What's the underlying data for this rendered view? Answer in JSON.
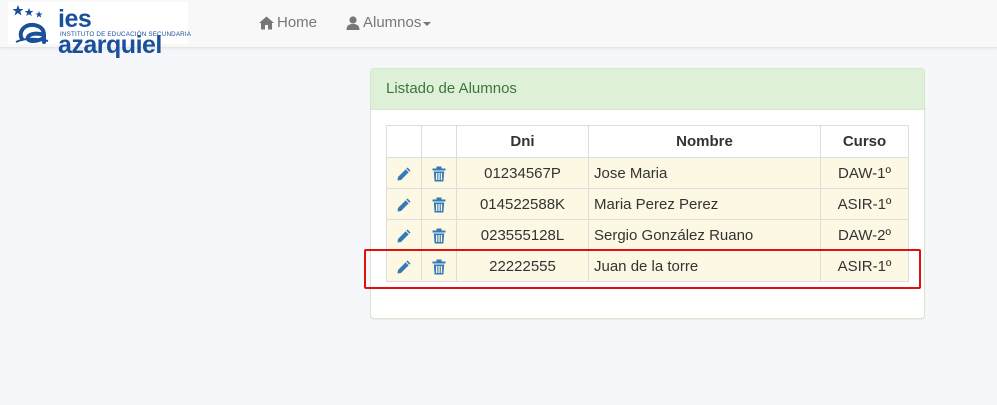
{
  "navbar": {
    "brand": {
      "name": "ies azarquiel",
      "subtitle": "INSTITUTO DE EDUCACIÓN SECUNDARIA"
    },
    "home_label": "Home",
    "alumnos_label": "Alumnos"
  },
  "panel": {
    "title": "Listado de Alumnos",
    "columns": [
      "",
      "",
      "Dni",
      "Nombre",
      "Curso"
    ],
    "rows": [
      {
        "dni": "01234567P",
        "nombre": "Jose Maria",
        "curso": "DAW-1º"
      },
      {
        "dni": "014522588K",
        "nombre": "Maria Perez Perez",
        "curso": "ASIR-1º"
      },
      {
        "dni": "023555128L",
        "nombre": "Sergio González Ruano",
        "curso": "DAW-2º"
      },
      {
        "dni": "22222555",
        "nombre": "Juan de la torre",
        "curso": "ASIR-1º"
      }
    ]
  },
  "colors": {
    "brand": "#1a4f9c",
    "panel_heading_bg": "#dff0d8",
    "row_bg": "#fcf8e3",
    "icon": "#337ab7",
    "highlight": "#e01010"
  },
  "icons": {
    "home": "home-icon",
    "user": "user-icon",
    "edit": "pencil-icon",
    "delete": "trash-icon"
  },
  "highlighted_row": 3
}
